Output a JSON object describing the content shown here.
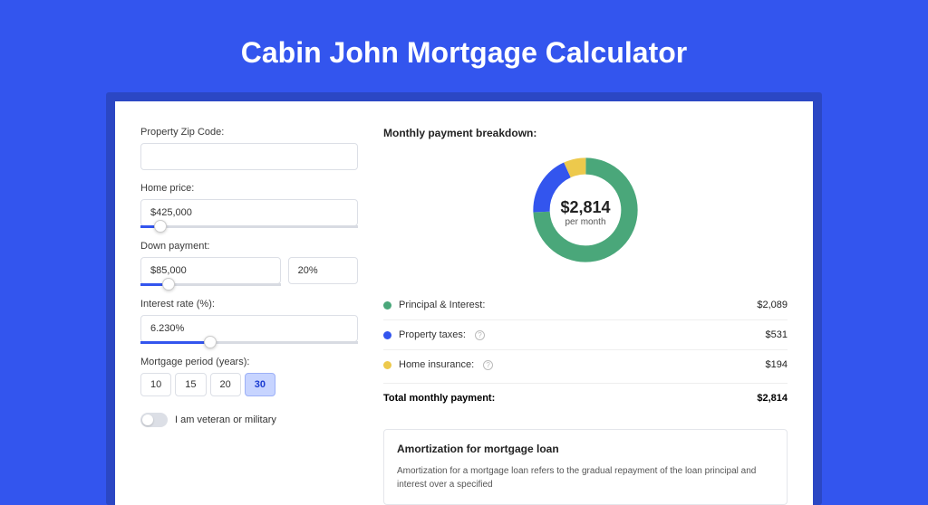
{
  "title": "Cabin John Mortgage Calculator",
  "form": {
    "zip_label": "Property Zip Code:",
    "zip_value": "",
    "home_price_label": "Home price:",
    "home_price_value": "$425,000",
    "down_payment_label": "Down payment:",
    "down_payment_value": "$85,000",
    "down_payment_pct": "20%",
    "interest_label": "Interest rate (%):",
    "interest_value": "6.230%",
    "period_label": "Mortgage period (years):",
    "periods": [
      "10",
      "15",
      "20",
      "30"
    ],
    "period_selected": "30",
    "veteran_label": "I am veteran or military"
  },
  "breakdown": {
    "title": "Monthly payment breakdown:",
    "donut_amount": "$2,814",
    "donut_sub": "per month",
    "items": [
      {
        "label": "Principal & Interest:",
        "value": "$2,089",
        "color": "#4aa77a"
      },
      {
        "label": "Property taxes:",
        "value": "$531",
        "color": "#3355EE",
        "info": true
      },
      {
        "label": "Home insurance:",
        "value": "$194",
        "color": "#edc94c",
        "info": true
      }
    ],
    "total_label": "Total monthly payment:",
    "total_value": "$2,814"
  },
  "amortization": {
    "title": "Amortization for mortgage loan",
    "text": "Amortization for a mortgage loan refers to the gradual repayment of the loan principal and interest over a specified"
  },
  "chart_data": {
    "type": "pie",
    "title": "Monthly payment breakdown",
    "series": [
      {
        "name": "Principal & Interest",
        "value": 2089,
        "color": "#4aa77a"
      },
      {
        "name": "Property taxes",
        "value": 531,
        "color": "#3355EE"
      },
      {
        "name": "Home insurance",
        "value": 194,
        "color": "#edc94c"
      }
    ],
    "total": 2814
  }
}
